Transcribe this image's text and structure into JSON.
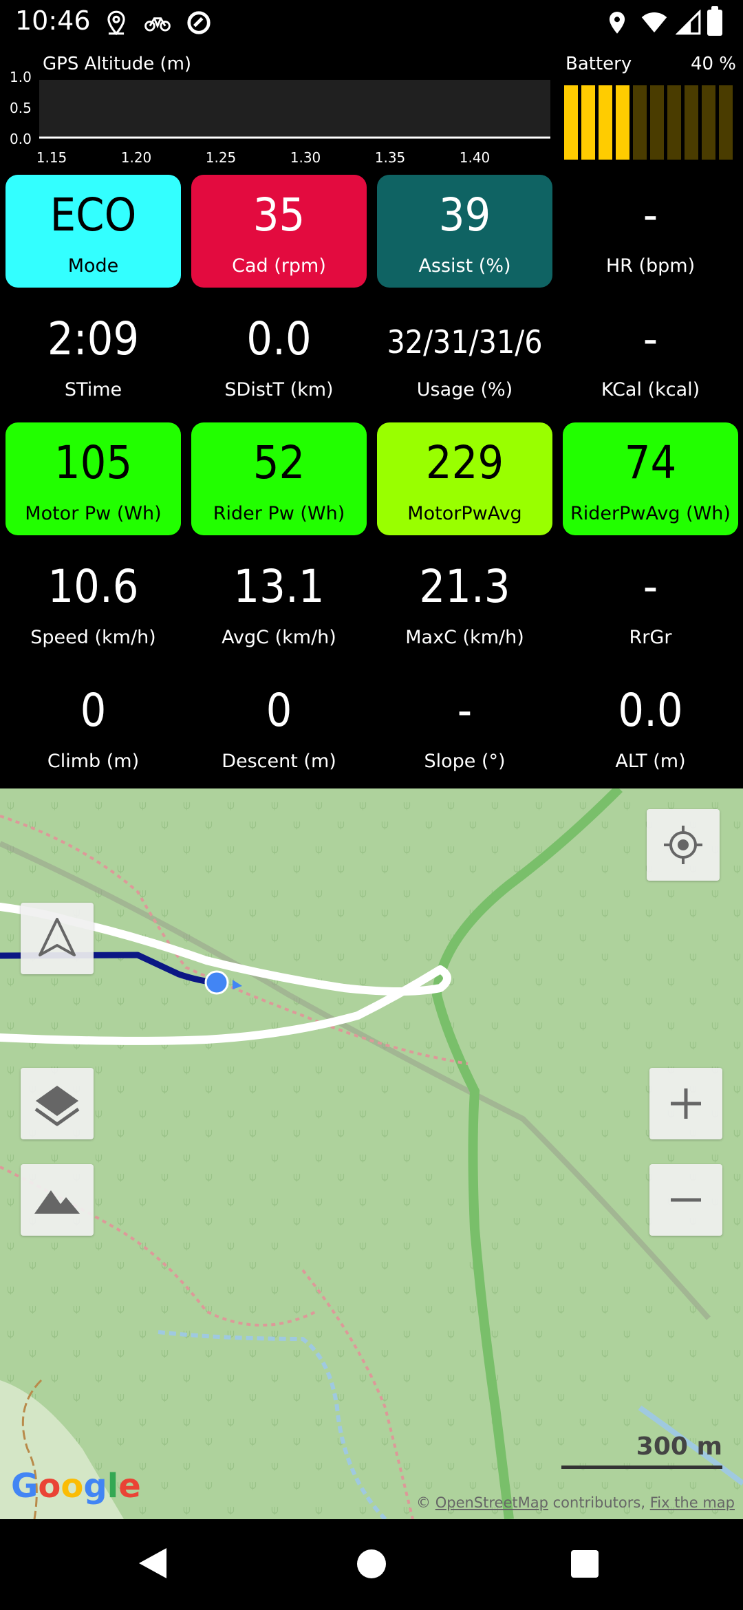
{
  "status_bar": {
    "time": "10:46",
    "icons": [
      "location-pin-icon",
      "bicycle-icon",
      "data-saver-icon",
      "location-pin-icon",
      "wifi-icon",
      "signal-icon",
      "battery-icon"
    ]
  },
  "altitude_chart": {
    "title": "GPS Altitude (m)",
    "y_ticks": [
      "1.0",
      "0.5",
      "0.0"
    ],
    "x_ticks": [
      "1.15",
      "1.20",
      "1.25",
      "1.30",
      "1.35",
      "1.40"
    ]
  },
  "battery": {
    "title": "Battery",
    "percent": "40 %",
    "segments_total": 10,
    "segments_on": 4,
    "on_color": "#ffcc00",
    "off_color": "#4a3c00"
  },
  "tiles": [
    {
      "value": "ECO",
      "label": "Mode",
      "bg": "#33ffff",
      "fg": "#000000"
    },
    {
      "value": "35",
      "label": "Cad (rpm)",
      "bg": "#e30b3f",
      "fg": "#ffffff"
    },
    {
      "value": "39",
      "label": "Assist (%)",
      "bg": "#0f6363",
      "fg": "#ffffff"
    },
    {
      "value": "-",
      "label": "HR (bpm)",
      "bg": "#000000",
      "fg": "#ffffff"
    },
    {
      "value": "2:09",
      "label": "STime",
      "bg": "#000000",
      "fg": "#ffffff"
    },
    {
      "value": "0.0",
      "label": "SDistT (km)",
      "bg": "#000000",
      "fg": "#ffffff"
    },
    {
      "value": "32/31/31/6",
      "label": "Usage (%)",
      "bg": "#000000",
      "fg": "#ffffff"
    },
    {
      "value": "-",
      "label": "KCal (kcal)",
      "bg": "#000000",
      "fg": "#ffffff"
    },
    {
      "value": "105",
      "label": "Motor Pw (Wh)",
      "bg": "#22ff00",
      "fg": "#000000"
    },
    {
      "value": "52",
      "label": "Rider Pw (Wh)",
      "bg": "#22ff00",
      "fg": "#000000"
    },
    {
      "value": "229",
      "label": "MotorPwAvg",
      "bg": "#99ff00",
      "fg": "#000000"
    },
    {
      "value": "74",
      "label": "RiderPwAvg (Wh)",
      "bg": "#22ff00",
      "fg": "#000000"
    },
    {
      "value": "10.6",
      "label": "Speed (km/h)",
      "bg": "#000000",
      "fg": "#ffffff"
    },
    {
      "value": "13.1",
      "label": "AvgC (km/h)",
      "bg": "#000000",
      "fg": "#ffffff"
    },
    {
      "value": "21.3",
      "label": "MaxC (km/h)",
      "bg": "#000000",
      "fg": "#ffffff"
    },
    {
      "value": "-",
      "label": "RrGr",
      "bg": "#000000",
      "fg": "#ffffff"
    },
    {
      "value": "0",
      "label": "Climb (m)",
      "bg": "#000000",
      "fg": "#ffffff"
    },
    {
      "value": "0",
      "label": "Descent (m)",
      "bg": "#000000",
      "fg": "#ffffff"
    },
    {
      "value": "-",
      "label": "Slope (°)",
      "bg": "#000000",
      "fg": "#ffffff"
    },
    {
      "value": "0.0",
      "label": "ALT (m)",
      "bg": "#000000",
      "fg": "#ffffff"
    }
  ],
  "map": {
    "scale_label": "300 m",
    "google_logo": "Google",
    "attribution_prefix": "©",
    "attribution_link1": "OpenStreetMap",
    "attribution_middle": "contributors,",
    "attribution_link2": "Fix the map",
    "buttons": {
      "my_location": "my-location-icon",
      "navigate": "navigation-arrow-icon",
      "layers": "layers-icon",
      "terrain": "terrain-icon",
      "zoom_in": "plus-icon",
      "zoom_out": "minus-icon"
    }
  },
  "nav_bar": {
    "back": "back-icon",
    "home": "home-icon",
    "recents": "recents-icon"
  }
}
